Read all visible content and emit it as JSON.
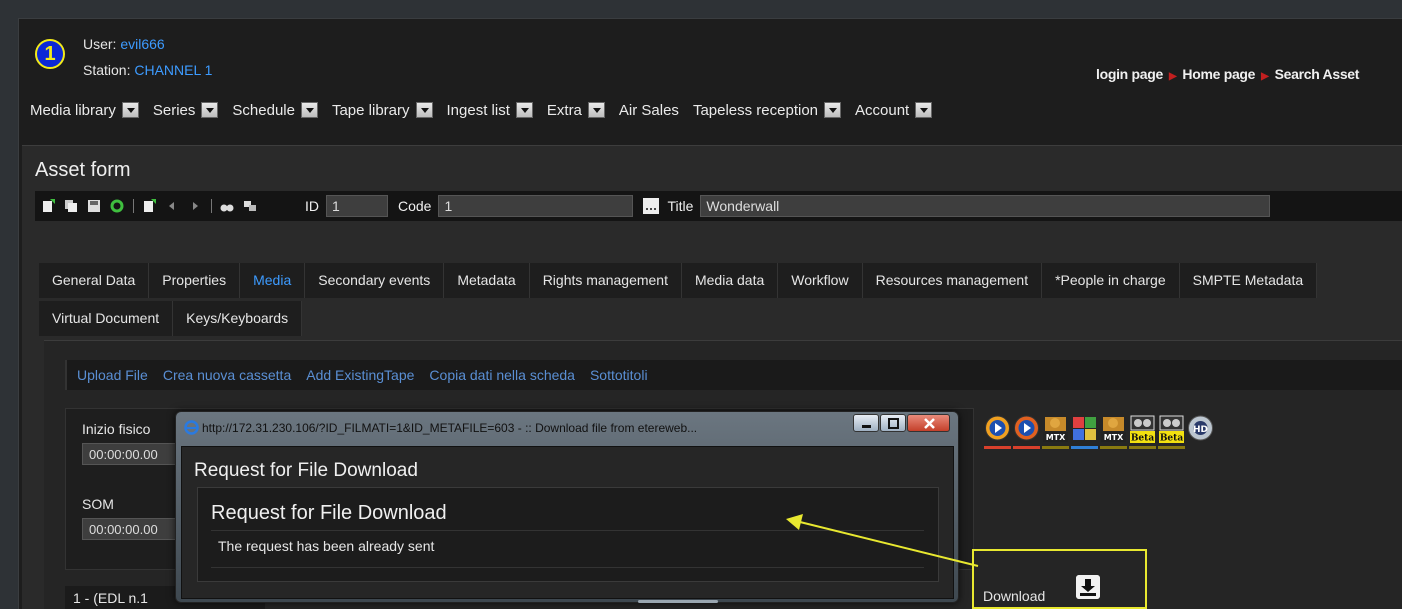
{
  "header": {
    "station_number": "1",
    "user_label": "User:",
    "user_name": "evil666",
    "station_label": "Station:",
    "station_name": "CHANNEL 1",
    "breadcrumbs": [
      "login page",
      "Home page",
      "Search Asset"
    ]
  },
  "menu": [
    {
      "label": "Media library",
      "dropdown": true
    },
    {
      "label": "Series",
      "dropdown": true
    },
    {
      "label": "Schedule",
      "dropdown": true
    },
    {
      "label": "Tape library",
      "dropdown": true
    },
    {
      "label": "Ingest list",
      "dropdown": true
    },
    {
      "label": "Extra",
      "dropdown": true
    },
    {
      "label": "Air Sales",
      "dropdown": false
    },
    {
      "label": "Tapeless reception",
      "dropdown": true
    },
    {
      "label": "Account",
      "dropdown": true
    }
  ],
  "asset_form": {
    "title": "Asset form",
    "id_label": "ID",
    "id_value": "1",
    "code_label": "Code",
    "code_value": "1",
    "title_label": "Title",
    "title_value": "Wonderwall"
  },
  "tabs_row1": [
    "General Data",
    "Properties",
    "Media",
    "Secondary events",
    "Metadata",
    "Rights management",
    "Media data",
    "Workflow",
    "Resources management",
    "*People in charge",
    "SMPTE Metadata"
  ],
  "tabs_row2": [
    "Virtual Document",
    "Keys/Keyboards"
  ],
  "active_tab": "Media",
  "media_toolbar": [
    "Upload File",
    "Crea nuova cassetta",
    "Add ExistingTape",
    "Copia dati nella scheda",
    "Sottotitoli"
  ],
  "fields": {
    "inizio_label": "Inizio fisico",
    "inizio_value": "00:00:00.00",
    "som_label": "SOM",
    "som_value": "00:00:00.00"
  },
  "edl_row": "1 - (EDL n.1",
  "media_icons": [
    {
      "name": "play-orange-icon",
      "bar_color": "#d8402c"
    },
    {
      "name": "play-red-icon",
      "bar_color": "#d8402c"
    },
    {
      "name": "mtx-tape-icon",
      "label": "MTX",
      "bar_color": "#8a7a10"
    },
    {
      "name": "puzzle-icon",
      "bar_color": "#2f7fd6"
    },
    {
      "name": "mtx-tape-icon",
      "label": "MTX",
      "bar_color": "#8a7a10"
    },
    {
      "name": "beta-tape-icon",
      "label": "Beta",
      "bar_color": "#8a7a10"
    },
    {
      "name": "beta-tape-icon",
      "label": "Beta",
      "bar_color": "#8a7a10"
    },
    {
      "name": "hd-disc-icon",
      "label": "HD",
      "bar_color": ""
    }
  ],
  "download": {
    "label": "Download"
  },
  "popup": {
    "window_title": "http://172.31.230.106/?ID_FILMATI=1&ID_METAFILE=603 - :: Download file from etereweb...",
    "heading": "Request for File Download",
    "box_heading": "Request for File Download",
    "message": "The request has been already sent"
  },
  "colors": {
    "accent": "#3d9bff",
    "annotation": "#e8e830"
  }
}
